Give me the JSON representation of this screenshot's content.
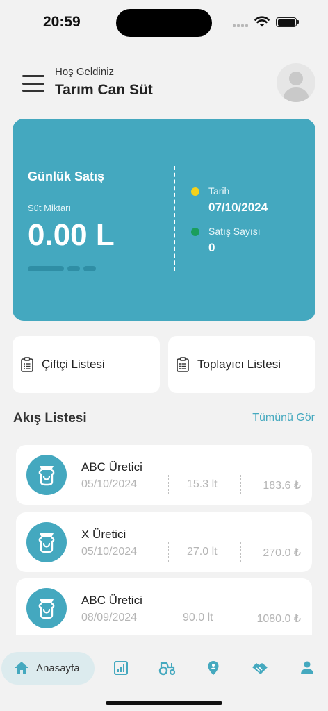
{
  "status_bar": {
    "time": "20:59"
  },
  "header": {
    "greeting": "Hoş Geldiniz",
    "company": "Tarım Can Süt"
  },
  "sales_card": {
    "title": "Günlük Satış",
    "milk_label": "Süt Miktarı",
    "milk_value": "0.00 L",
    "date_label": "Tarih",
    "date_value": "07/10/2024",
    "count_label": "Satış Sayısı",
    "count_value": "0",
    "colors": {
      "background": "#44a8bf",
      "date_dot": "#f5d21a",
      "count_dot": "#1a9e5c"
    }
  },
  "quick_actions": [
    {
      "label": "Çiftçi Listesi",
      "icon": "clipboard-list-icon"
    },
    {
      "label": "Toplayıcı Listesi",
      "icon": "clipboard-list-icon"
    }
  ],
  "flow": {
    "title": "Akış Listesi",
    "see_all": "Tümünü Gör",
    "items": [
      {
        "name": "ABC Üretici",
        "date": "05/10/2024",
        "quantity": "15.3 lt",
        "price": "183.6 ₺"
      },
      {
        "name": "X Üretici",
        "date": "05/10/2024",
        "quantity": "27.0 lt",
        "price": "270.0 ₺"
      },
      {
        "name": "ABC Üretici",
        "date": "08/09/2024",
        "quantity": "90.0 lt",
        "price": "1080.0 ₺"
      }
    ]
  },
  "tab_bar": {
    "active_label": "Anasayfa",
    "tabs": [
      "home-icon",
      "chart-icon",
      "tractor-icon",
      "location-pin-icon",
      "handshake-icon",
      "user-icon"
    ],
    "accent": "#45a9bf"
  }
}
